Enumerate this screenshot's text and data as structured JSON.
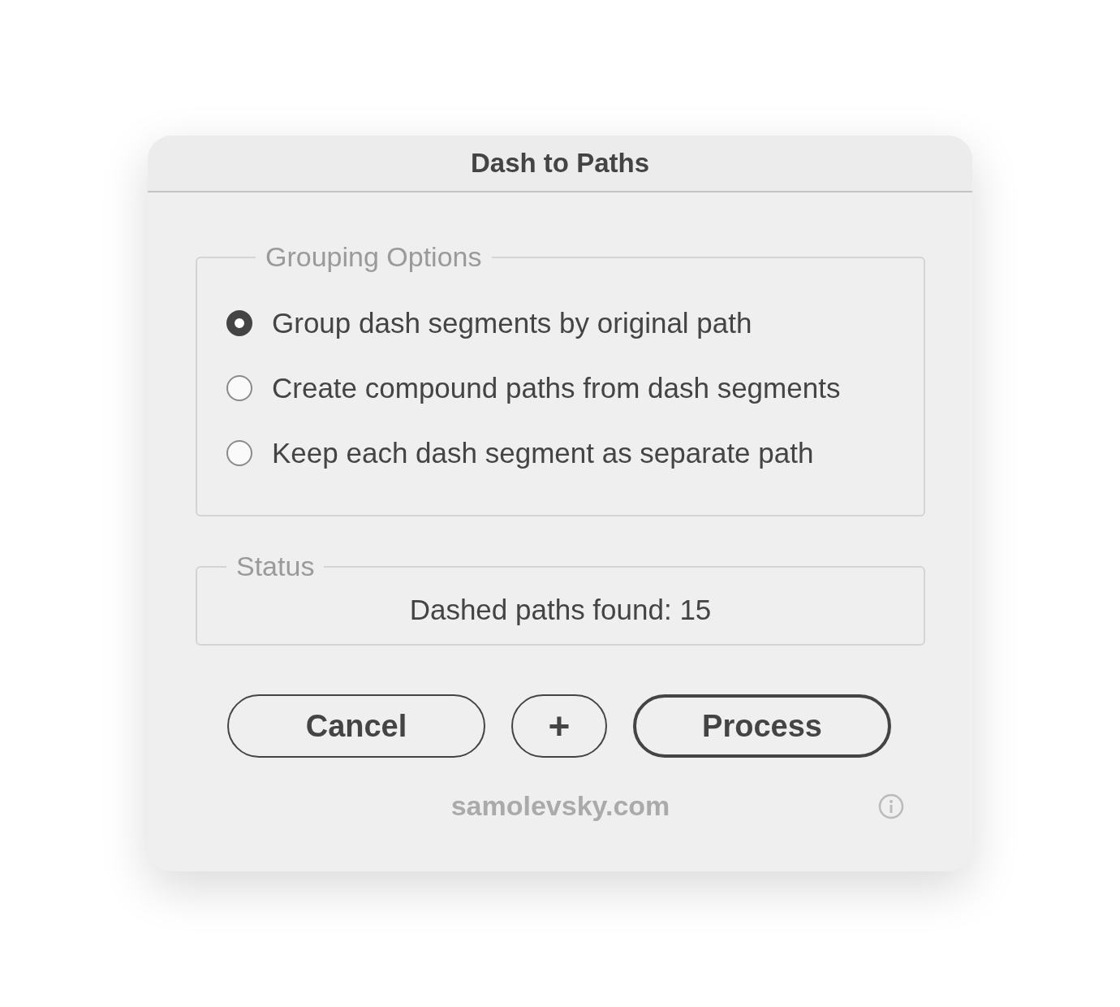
{
  "window": {
    "title": "Dash to Paths"
  },
  "grouping": {
    "legend": "Grouping Options",
    "options": [
      {
        "label": "Group dash segments by original path",
        "selected": true
      },
      {
        "label": "Create compound paths from dash segments",
        "selected": false
      },
      {
        "label": "Keep each dash segment as separate path",
        "selected": false
      }
    ]
  },
  "status": {
    "legend": "Status",
    "text": "Dashed paths found: 15"
  },
  "buttons": [
    {
      "kind": "cancel",
      "label": "Cancel"
    },
    {
      "kind": "add",
      "label": "+"
    },
    {
      "kind": "primary",
      "label": "Process"
    }
  ],
  "footer": {
    "link": "samolevsky.com"
  }
}
